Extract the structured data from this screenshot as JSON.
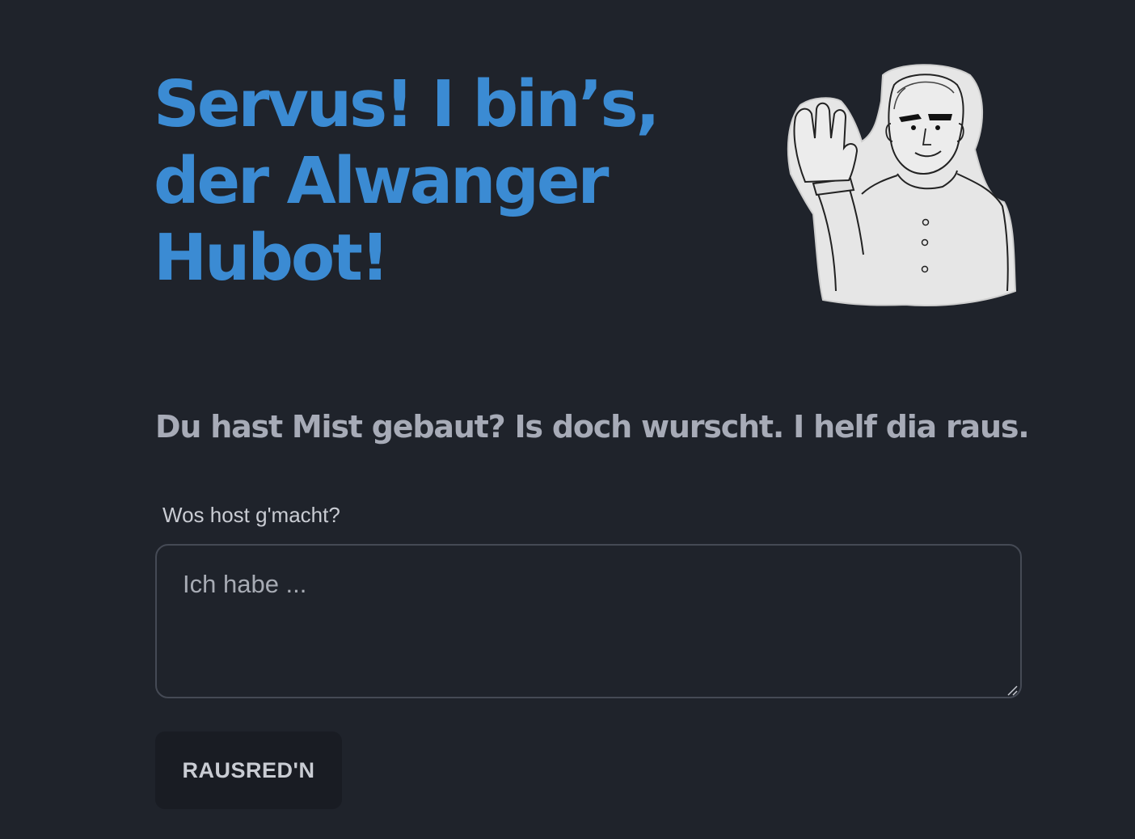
{
  "hero": {
    "title_lines": [
      "Servus! I bin’s,",
      "der Alwanger",
      "Hubot!"
    ],
    "image": "waving-man-illustration"
  },
  "subtitle": "Du hast Mist gebaut? Is doch wurscht. I helf dia raus.",
  "form": {
    "label": "Wos host g'macht?",
    "placeholder": "Ich habe ...",
    "value": "",
    "submit_label": "RAUSRED'N"
  },
  "theme": {
    "background": "#1f232b",
    "accent": "#3b8bd3",
    "subtitle_color": "#a7abb7",
    "button_background": "#191c23"
  }
}
